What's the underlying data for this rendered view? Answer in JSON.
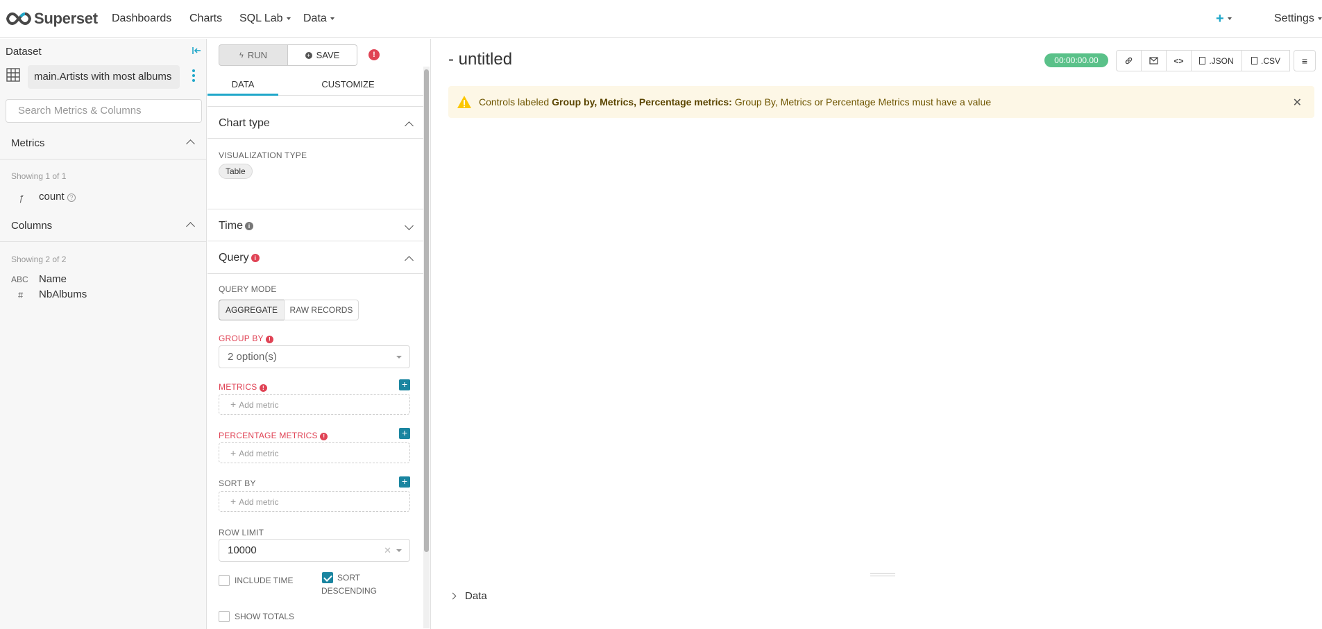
{
  "nav": {
    "brand": "Superset",
    "items": [
      {
        "label": "Dashboards"
      },
      {
        "label": "Charts"
      },
      {
        "label": "SQL Lab"
      },
      {
        "label": "Data"
      }
    ],
    "plus": "+",
    "settings": "Settings"
  },
  "dataset": {
    "header": "Dataset",
    "name": "main.Artists with most albums",
    "search_placeholder": "Search Metrics & Columns",
    "metrics_title": "Metrics",
    "metrics_showing": "Showing 1 of 1",
    "metrics": [
      {
        "icon": "ƒ",
        "label": "count"
      }
    ],
    "columns_title": "Columns",
    "columns_showing": "Showing 2 of 2",
    "columns": [
      {
        "icon": "ABC",
        "label": "Name"
      },
      {
        "icon": "#",
        "label": "NbAlbums"
      }
    ]
  },
  "control": {
    "run": "RUN",
    "save": "SAVE",
    "tab_data": "DATA",
    "tab_customize": "CUSTOMIZE",
    "chart_type_title": "Chart type",
    "viz_type_label": "VISUALIZATION TYPE",
    "viz_type_value": "Table",
    "time_title": "Time",
    "query_title": "Query",
    "query_mode_label": "QUERY MODE",
    "mode_aggregate": "AGGREGATE",
    "mode_raw": "RAW RECORDS",
    "group_by_label": "GROUP BY",
    "group_by_value": "2 option(s)",
    "metrics_label": "METRICS",
    "add_metric": "Add metric",
    "percentage_metrics_label": "PERCENTAGE METRICS",
    "sort_by_label": "SORT BY",
    "row_limit_label": "ROW LIMIT",
    "row_limit_value": "10000",
    "include_time": "INCLUDE TIME",
    "sort_descending_1": "SORT",
    "sort_descending_2": "DESCENDING",
    "show_totals": "SHOW TOTALS"
  },
  "chart": {
    "title": "- untitled",
    "timer": "00:00:00.00",
    "json_btn": ".JSON",
    "csv_btn": ".CSV",
    "alert_prefix": "Controls labeled",
    "alert_bold": "Group by, Metrics, Percentage metrics:",
    "alert_msg": "Group By, Metrics or Percentage Metrics must have a value",
    "data_toggle": "Data"
  },
  "colors": {
    "accent": "#20a7c9",
    "error": "#e04355",
    "success": "#5ac189",
    "alert_bg": "#fdf7e6"
  }
}
